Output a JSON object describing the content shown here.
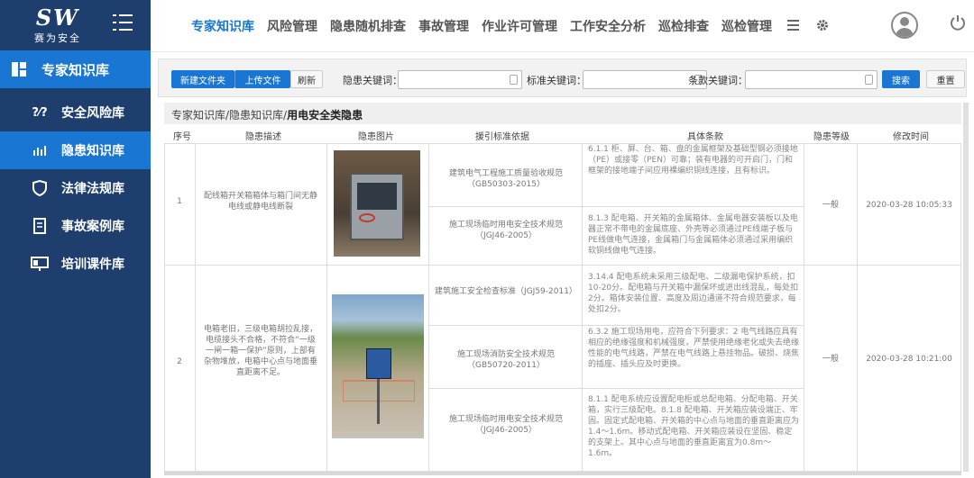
{
  "brand": {
    "logo_text": "SW",
    "logo_sub": "赛为安全"
  },
  "sidebar": {
    "section_title": "专家知识库",
    "items": [
      {
        "label": "安全风险库",
        "icon": "question-icon",
        "active": false
      },
      {
        "label": "隐患知识库",
        "icon": "chart-icon",
        "active": true
      },
      {
        "label": "法律法规库",
        "icon": "shield-icon",
        "active": false
      },
      {
        "label": "事故案例库",
        "icon": "document-icon",
        "active": false
      },
      {
        "label": "培训课件库",
        "icon": "presentation-icon",
        "active": false
      }
    ]
  },
  "topnav": {
    "tabs": [
      "专家知识库",
      "风险管理",
      "隐患随机排查",
      "事故管理",
      "作业许可管理",
      "工作安全分析",
      "巡检排查",
      "巡检管理"
    ]
  },
  "toolbar": {
    "new_folder": "新建文件夹",
    "upload": "上传文件",
    "refresh": "刷新",
    "hazard_keyword_label": "隐患关键词：",
    "standard_keyword_label": "标准关键词：",
    "clause_keyword_label": "条款关键词：",
    "search": "搜索",
    "reset": "重置"
  },
  "breadcrumb": {
    "path": "专家知识库/隐患知识库/",
    "current": "用电安全类隐患"
  },
  "table": {
    "headers": [
      "序号",
      "隐患描述",
      "隐患图片",
      "援引标准依据",
      "具体条款",
      "隐患等级",
      "修改时间"
    ],
    "rows": [
      {
        "index": "1",
        "description": "配线箱开关箱箱体与箱门间无静电线或静电线断裂",
        "level": "一般",
        "time": "2020-03-28 10:05:33",
        "standards": [
          {
            "name": "建筑电气工程施工质量验收规范（GB50303-2015）",
            "clause": "6.1.1 柜、屏、台、箱、盘的金属框架及基础型钢必须接地（PE）或接零（PEN）可靠；装有电器的可开启门，门和框架的接地端子间应用裸编织铜线连接，且有标识。"
          },
          {
            "name": "施工现场临时用电安全技术规范（JGJ46-2005）",
            "clause": "8.1.3 配电箱、开关箱的金属箱体、金属电器安装板以及电器正常不带电的金属底座、外壳等必须通过PE线端子板与PE线做电气连接，金属箱门与金属箱体必须通过采用编织软铜线做电气连接。"
          }
        ]
      },
      {
        "index": "2",
        "description": "电箱老旧，三级电箱胡拉乱接，电缆接头不合格，不符合“一级一闸一箱一保护”原则，上部有杂物堆放，电箱中心点与地面垂直距离不足。",
        "level": "一般",
        "time": "2020-03-28 10:21:00",
        "standards": [
          {
            "name": "建筑施工安全检查标准（JGJ59-2011）",
            "clause": "3.14.4 配电系统未采用三级配电、二级漏电保护系统，扣10-20分。配电箱与开关箱中漏保坏或进出线混乱，每处扣2分。箱体安装位置、高度及周边通道不符合规范要求，每处扣2分。"
          },
          {
            "name": "施工现场消防安全技术规范（GB50720-2011）",
            "clause": "6.3.2 施工现场用电，应符合下列要求：2 电气线路应具有相应的绝缘强度和机械强度，严禁使用绝缘老化或失去绝缘性能的电气线路，严禁在电气线路上悬挂物品。破损、烧焦的插座、插头应及时更换。"
          },
          {
            "name": "施工现场临时用电安全技术规范（JGJ46-2005）",
            "clause": "8.1.1 配电系统应设置配电柜或总配电箱、分配电箱、开关箱，实行三级配电。8.1.8 配电箱、开关箱应装设端正、牢固。固定式配电箱、开关箱的中心点与地面的垂直距离应为1.4～1.6m。移动式配电箱、开关箱应装设在坚固、稳定的支架上。其中心点与地面的垂直距离宜为0.8m～1.6m。"
          }
        ]
      }
    ]
  }
}
